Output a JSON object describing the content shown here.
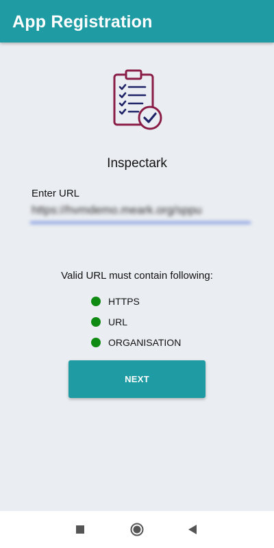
{
  "app_bar": {
    "title": "App Registration",
    "color": "#1f9ba4"
  },
  "logo": {
    "icon": "clipboard-checklist-icon"
  },
  "app_name": "Inspectark",
  "url_field": {
    "label": "Enter URL",
    "value": "https://hvmdemo.meark.org/sppu"
  },
  "validation": {
    "heading": "Valid URL must contain following:",
    "status_color": "#0f8a12",
    "rules": [
      {
        "label": "HTTPS"
      },
      {
        "label": "URL"
      },
      {
        "label": "ORGANISATION"
      }
    ]
  },
  "next_button": {
    "label": "NEXT"
  },
  "nav_bar": {
    "buttons": [
      {
        "icon": "recents-square-icon"
      },
      {
        "icon": "home-circle-icon"
      },
      {
        "icon": "back-triangle-icon"
      }
    ]
  }
}
